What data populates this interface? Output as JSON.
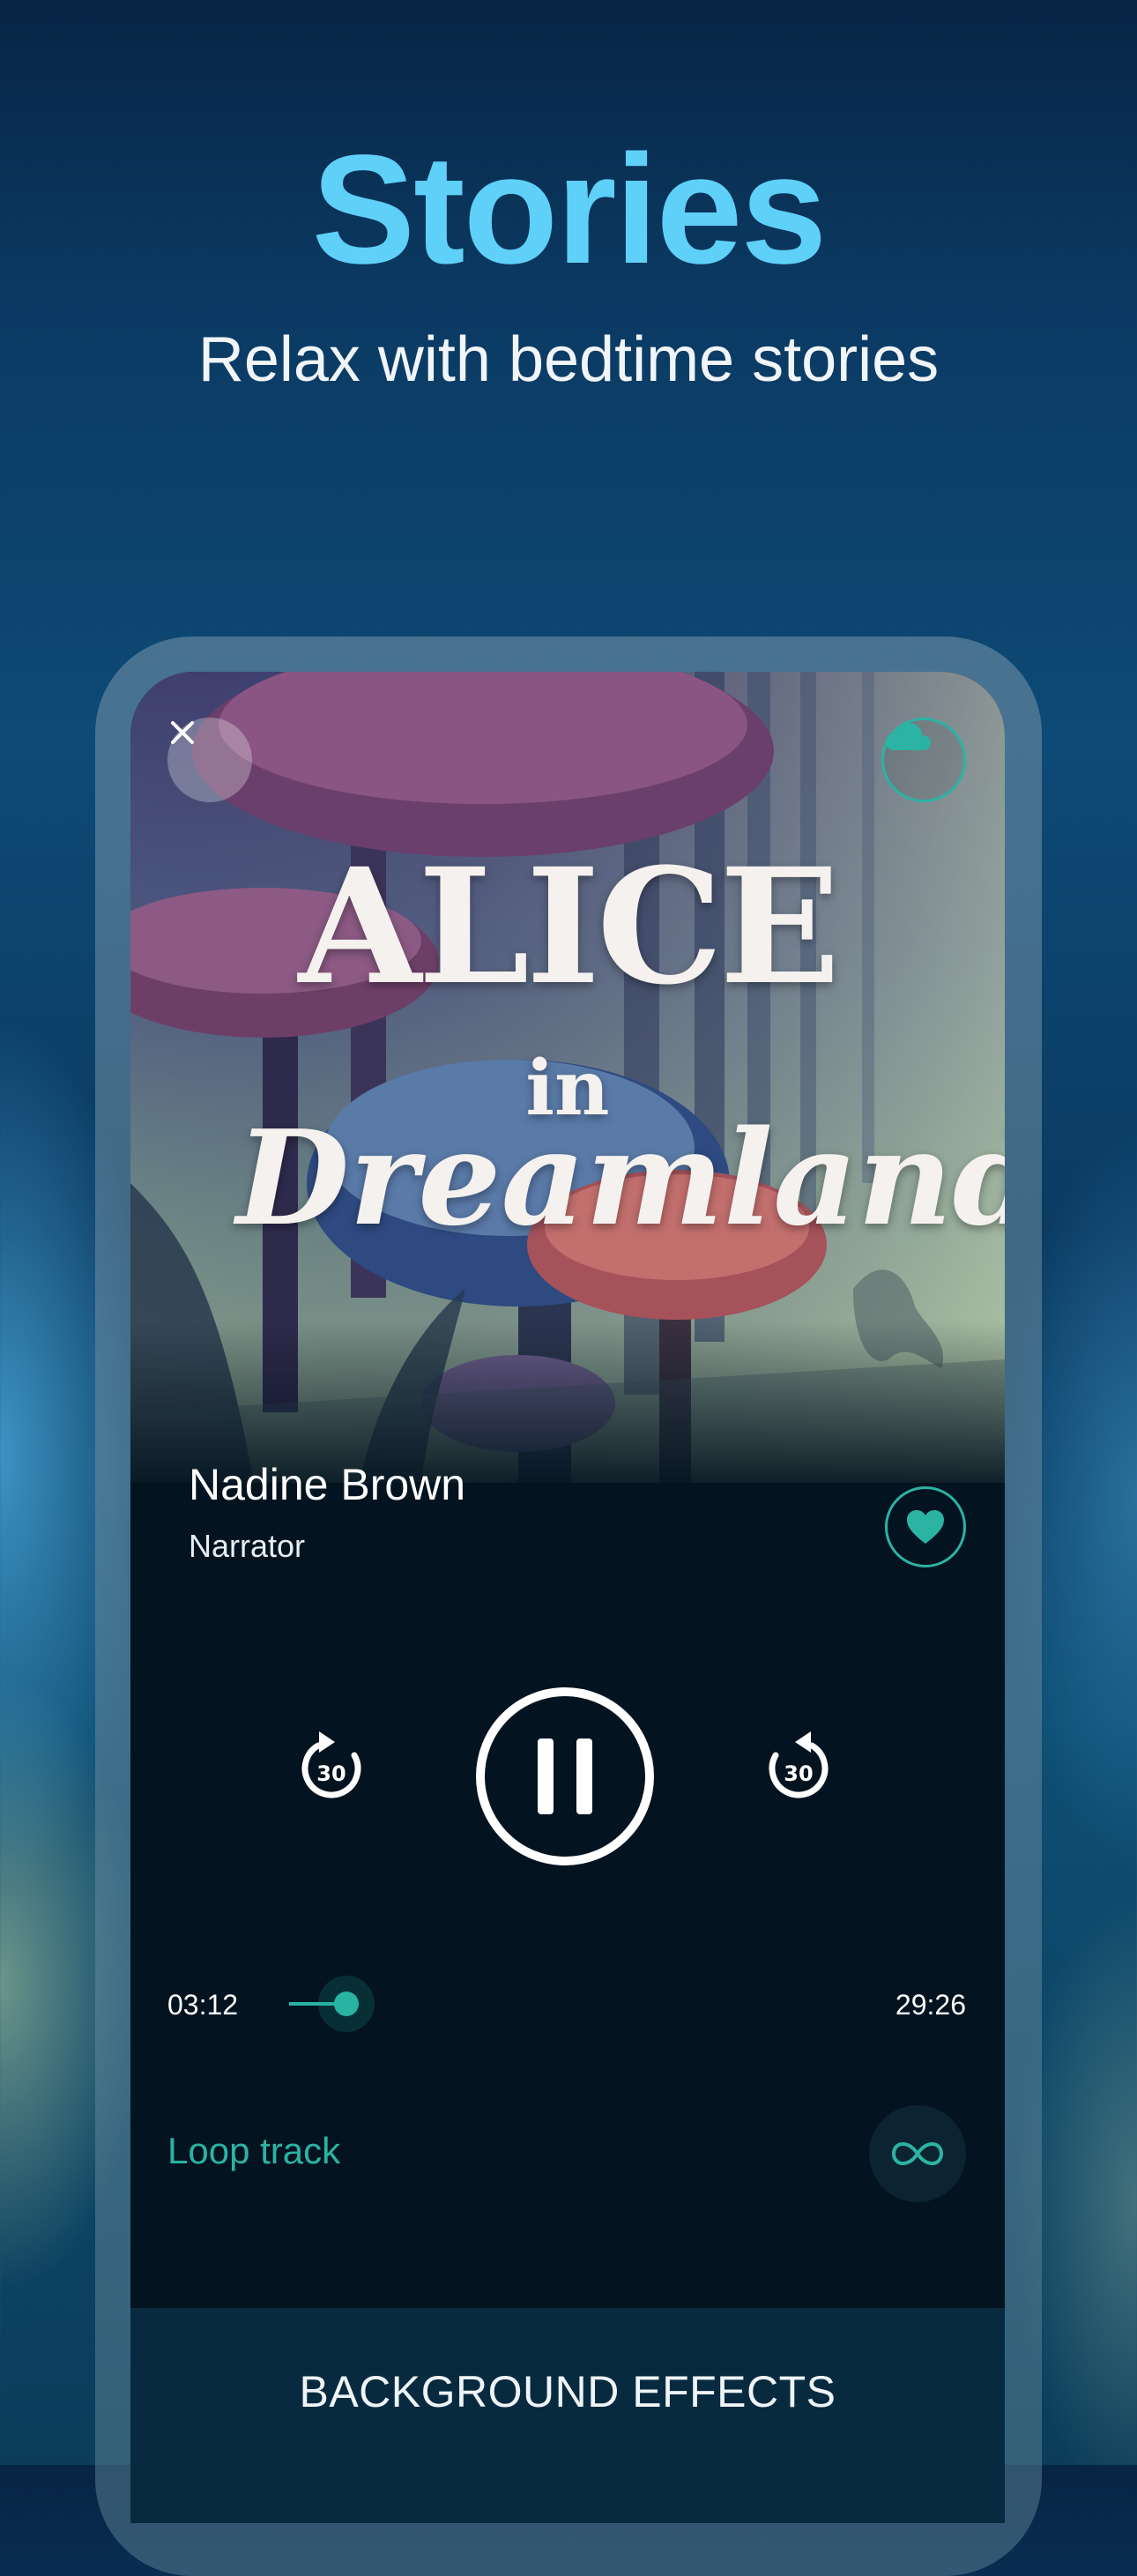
{
  "hero": {
    "title": "Stories",
    "subtitle": "Relax with bedtime stories"
  },
  "artwork": {
    "title_line1": "ALICE",
    "title_line2": "in",
    "title_line3": "Dreamland"
  },
  "narrator": {
    "name": "Nadine Brown",
    "role": "Narrator"
  },
  "controls": {
    "rewind_seconds": "30",
    "forward_seconds": "30"
  },
  "progress": {
    "elapsed": "03:12",
    "total": "29:26",
    "fraction": 0.109
  },
  "loop": {
    "label": "Loop track"
  },
  "effects": {
    "label": "BACKGROUND EFFECTS"
  },
  "colors": {
    "accent": "#2bb3a4",
    "hero_title": "#5fd0f7",
    "screen_bg": "#03131f"
  },
  "icons": {
    "close": "close-icon",
    "cloud": "cloud-icon",
    "favorite": "heart-icon",
    "rewind": "rewind-30-icon",
    "forward": "forward-30-icon",
    "pause": "pause-icon",
    "loop": "infinity-icon"
  }
}
